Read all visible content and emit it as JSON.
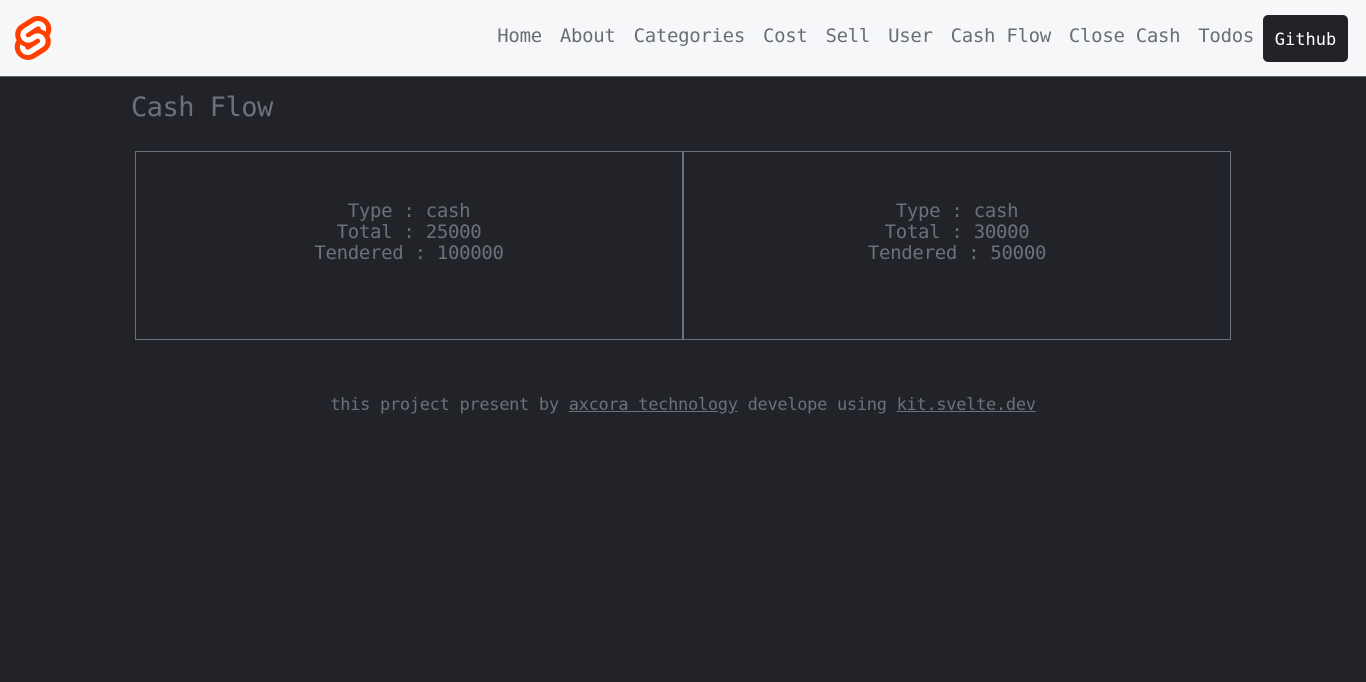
{
  "header": {
    "logo": "svelte-logo-icon",
    "brand_color": "#ff3e00",
    "nav": [
      {
        "label": "Home"
      },
      {
        "label": "About"
      },
      {
        "label": "Categories"
      },
      {
        "label": "Cost"
      },
      {
        "label": "Sell"
      },
      {
        "label": "User"
      },
      {
        "label": "Cash Flow"
      },
      {
        "label": "Close Cash"
      },
      {
        "label": "Todos"
      }
    ],
    "github_label": "Github"
  },
  "main": {
    "title": "Cash Flow",
    "cards": [
      {
        "type": "Type : cash",
        "total": "Total : 25000",
        "tendered": "Tendered : 100000"
      },
      {
        "type": "Type : cash",
        "total": "Total : 30000",
        "tendered": "Tendered : 50000"
      }
    ]
  },
  "footer": {
    "text_1": "this project present by ",
    "link_1": "axcora technology",
    "text_2": " develope using ",
    "link_2": "kit.svelte.dev"
  }
}
